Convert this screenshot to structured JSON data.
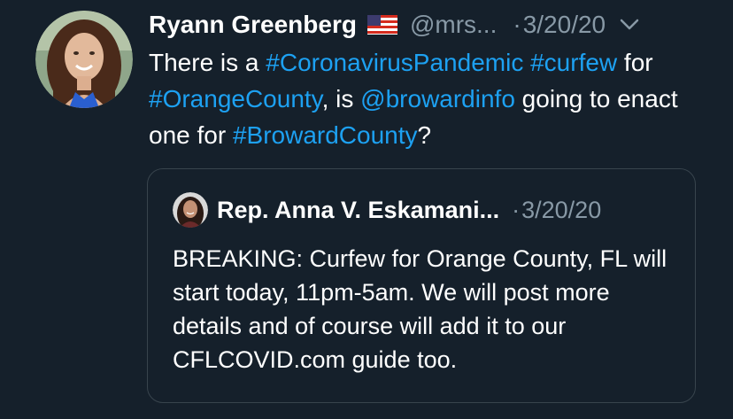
{
  "tweet": {
    "author_name": "Ryann Greenberg",
    "flag_icon": "us-flag-icon",
    "handle": "@mrs...",
    "dot": "·",
    "date": "3/20/20",
    "text": {
      "p1": "There is a ",
      "hashtag1": "#CoronavirusPandemic",
      "p2": " ",
      "hashtag2": "#curfew",
      "p3": " for ",
      "hashtag3": "#OrangeCounty",
      "p4": ", is ",
      "mention": "@browardinfo",
      "p5": " going to enact one for ",
      "hashtag4": "#BrowardCounty",
      "p6": "?"
    }
  },
  "quoted_tweet": {
    "author_name": "Rep. Anna V. Eskamani...",
    "dot": "·",
    "date": "3/20/20",
    "text": "BREAKING: Curfew for Orange County, FL will start today, 11pm-5am. We will post more details and of course will add it to our CFLCOVID.com guide too."
  },
  "colors": {
    "background": "#15202b",
    "link": "#1da1f2",
    "secondary_text": "#8899a6",
    "border": "#38444d"
  }
}
